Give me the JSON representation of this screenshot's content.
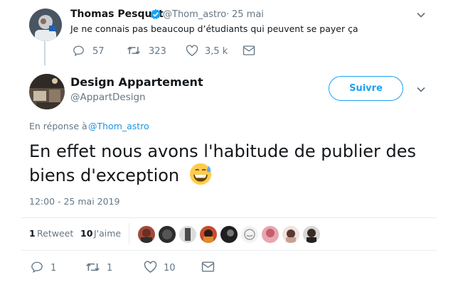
{
  "parent_tweet": {
    "author_name": "Thomas Pesquet",
    "handle": "@Thom_astro",
    "separator": "·",
    "date": "25 mai",
    "text": "Je ne connais pas beaucoup d’étudiants qui peuvent se payer ça",
    "replies": "57",
    "retweets": "323",
    "likes": "3,5 k",
    "icons": [
      "reply-icon",
      "retweet-icon",
      "like-icon",
      "share-icon",
      "verified-badge-icon",
      "chevron-down-icon"
    ]
  },
  "main_tweet": {
    "author_name": "Design Appartement",
    "handle": "@AppartDesign",
    "follow_label": "Suivre",
    "reply_prefix": "En réponse à",
    "reply_handle": "@Thom_astro",
    "text": "En effet nous avons l'habitude de publier des biens d'exception",
    "emoji": "grinning-face-with-sweat",
    "timestamp": "12:00 - 25 mai 2019",
    "retweet_count": "1",
    "retweet_label": "Retweet",
    "like_count": "10",
    "like_label": "J'aime",
    "action_replies": "1",
    "action_retweets": "1",
    "action_likes": "10"
  },
  "colors": {
    "accent": "#1da1f2",
    "link": "#1b95e0",
    "muted": "#657786",
    "thread_line": "#ccd6dd",
    "divider": "#e6ecf0"
  }
}
